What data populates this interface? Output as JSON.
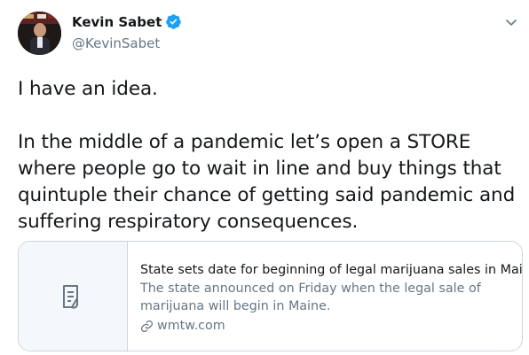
{
  "author": {
    "display_name": "Kevin Sabet",
    "handle": "@KevinSabet",
    "verified": true
  },
  "tweet": {
    "text": "I have an idea.\n\nIn the middle of a pandemic let’s open a STORE where people go to wait in line and buy things that quintuple their chance of getting said pandemic and suffering respiratory consequences."
  },
  "card": {
    "title": "State sets date for beginning of legal marijuana sales in Maine",
    "description": "The state announced on Friday when the legal sale of marijuana will begin in Maine.",
    "domain": "wmtw.com"
  },
  "icons": {
    "verified": "verified-badge-icon",
    "menu": "chevron-down-icon",
    "card_placeholder": "document-icon",
    "link": "link-icon"
  },
  "colors": {
    "verified": "#1da1f2",
    "secondary_text": "#657786",
    "border": "#ccd6dd"
  }
}
